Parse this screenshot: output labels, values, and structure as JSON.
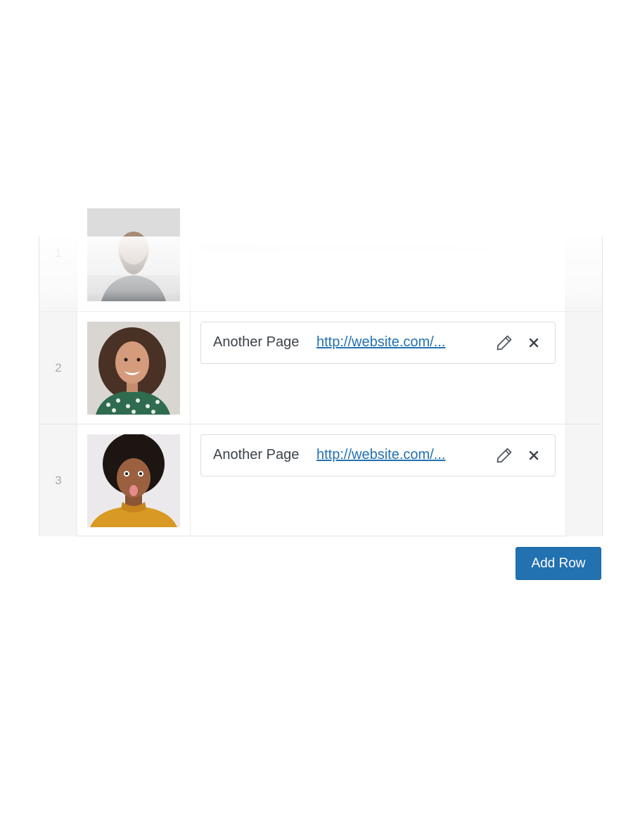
{
  "rows": [
    {
      "index": "1",
      "photo_icon": "person-photo-man-beard",
      "link_title": "",
      "link_url": ""
    },
    {
      "index": "2",
      "photo_icon": "person-photo-woman-curly-hair",
      "link_title": "Another Page",
      "link_url": "http://website.com/..."
    },
    {
      "index": "3",
      "photo_icon": "person-photo-woman-afro",
      "link_title": "Another Page",
      "link_url": "http://website.com/..."
    }
  ],
  "icons": {
    "edit": "pencil-icon",
    "remove": "close-icon"
  },
  "add_row_button": {
    "label": "Add Row"
  },
  "colors": {
    "accent": "#2271b1",
    "link": "#2271b1",
    "handle_bg": "#f5f5f5",
    "border": "#dcdcde"
  }
}
